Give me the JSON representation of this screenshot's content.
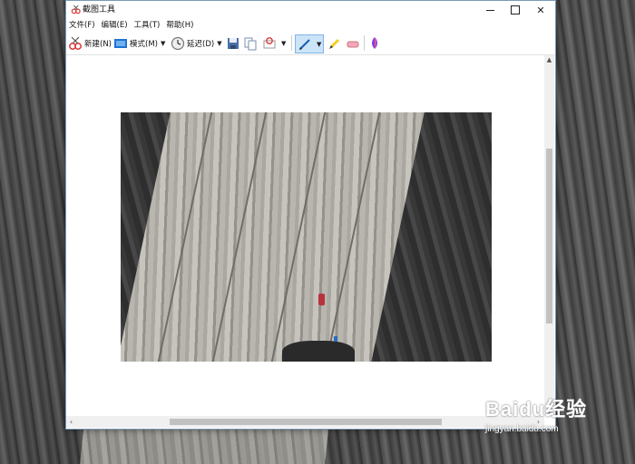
{
  "window": {
    "title": "截图工具"
  },
  "menu": [
    "文件(F)",
    "编辑(E)",
    "工具(T)",
    "帮助(H)"
  ],
  "toolbar": {
    "new_label": "新建(N)",
    "mode_label": "模式(M)",
    "delay_label": "延迟(D)"
  },
  "watermark": {
    "brand": "Baidu经验",
    "url": "jingyan.baidu.com"
  },
  "colors": {
    "accent": "#0078d7",
    "pen_active_bg": "#cce4f7"
  },
  "icons": [
    "snip-app-icon",
    "new-snip-icon",
    "mode-icon",
    "delay-clock-icon",
    "save-icon",
    "copy-icon",
    "send-icon",
    "pen-icon",
    "highlighter-icon",
    "eraser-icon",
    "paint3d-icon"
  ]
}
